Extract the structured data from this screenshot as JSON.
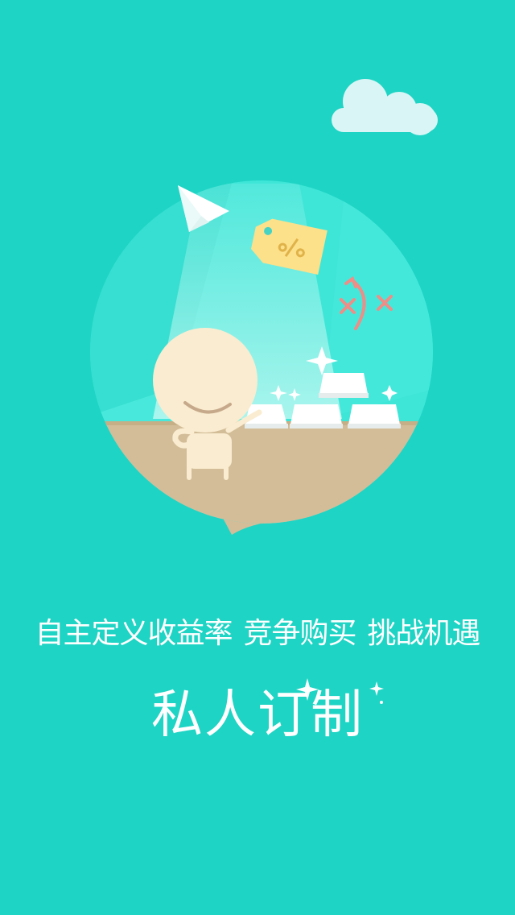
{
  "colors": {
    "background": "#1ed4c4",
    "text": "#ffffff",
    "circle_bg": "#3ee6d8",
    "ground": "#d3bd99",
    "character": "#faecd0",
    "tag": "#fde08a",
    "cross_mark": "#ef8d86"
  },
  "icons": {
    "cloud": "cloud-icon",
    "paper_plane": "paper-plane-icon",
    "percent_tag": "percent-tag-icon",
    "sparkle": "sparkle-icon",
    "character": "smiling-character"
  },
  "intro": {
    "features": [
      "自主定义收益率",
      "竞争购买",
      "挑战机遇"
    ],
    "title": "私人订制"
  }
}
